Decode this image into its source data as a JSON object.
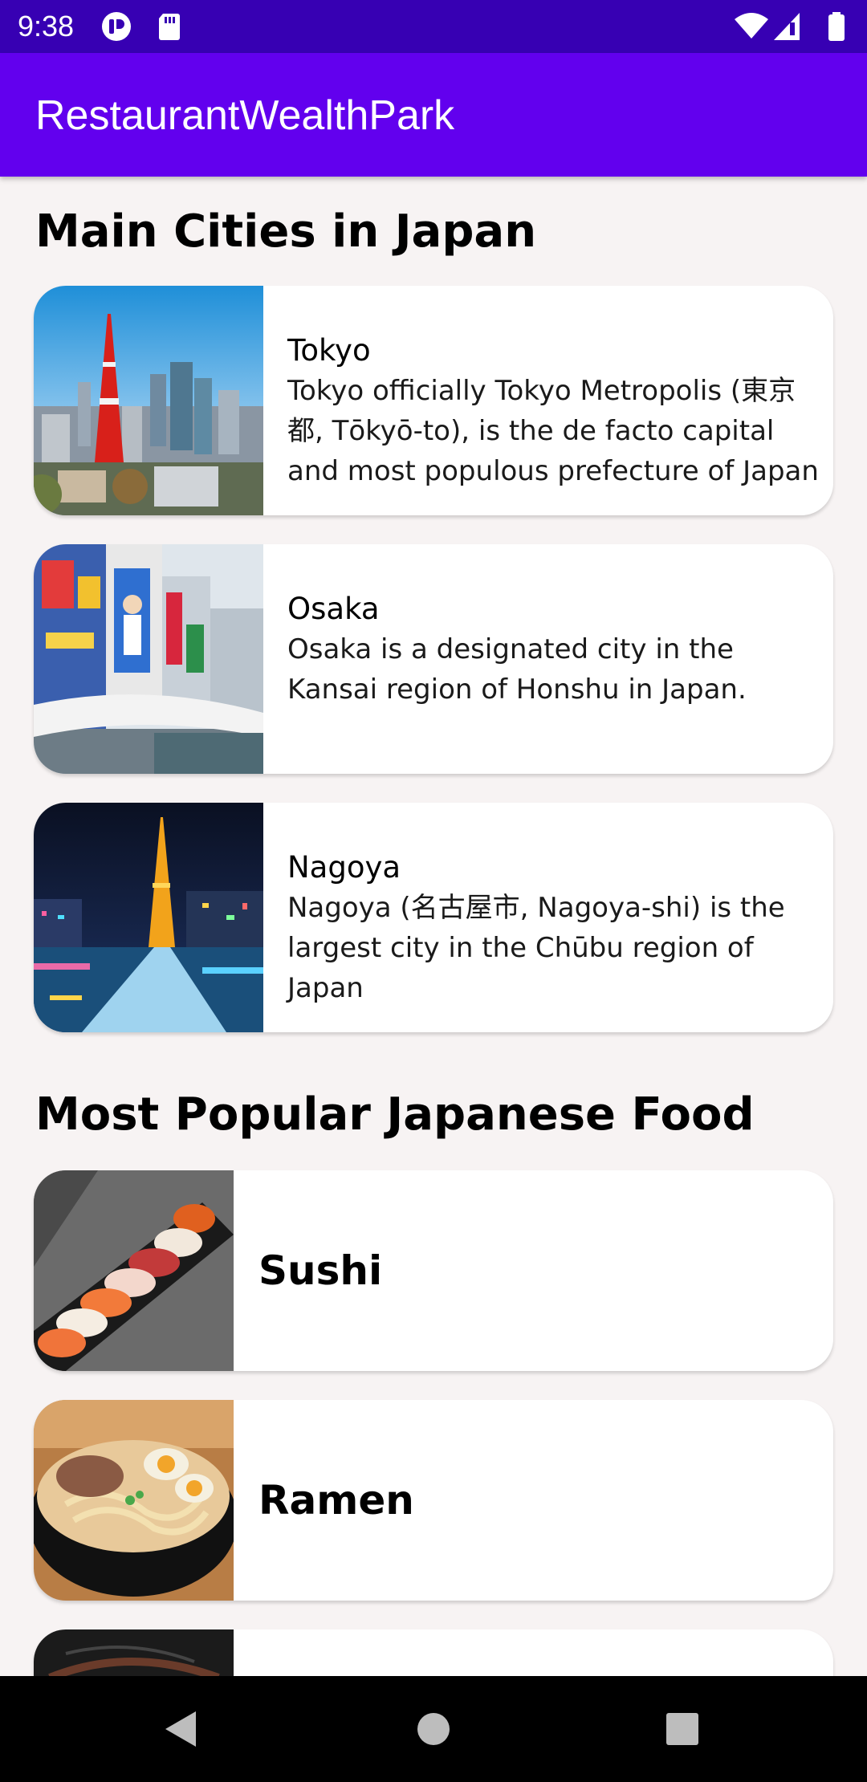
{
  "status_bar": {
    "time": "9:38",
    "left_icons": [
      "notification-icon",
      "sd-card-icon"
    ],
    "right_icons": [
      "wifi-icon",
      "signal-icon",
      "battery-icon"
    ]
  },
  "app_bar": {
    "title": "RestaurantWealthPark"
  },
  "cities_section": {
    "title": "Main Cities in Japan",
    "items": [
      {
        "name": "Tokyo",
        "description": "Tokyo officially Tokyo Metropolis (東京都, Tōkyō-to), is the de facto capital and most populous prefecture of Japan",
        "image": "tokyo-tower-photo"
      },
      {
        "name": "Osaka",
        "description": "Osaka is a designated city in the Kansai region of Honshu in Japan.",
        "image": "osaka-dotonbori-photo"
      },
      {
        "name": "Nagoya",
        "description": "Nagoya (名古屋市, Nagoya-shi) is the largest city in the Chūbu region of Japan",
        "image": "nagoya-tv-tower-photo"
      }
    ]
  },
  "food_section": {
    "title": "Most Popular Japanese Food",
    "items": [
      {
        "name": "Sushi",
        "image": "sushi-photo"
      },
      {
        "name": "Ramen",
        "image": "ramen-photo"
      },
      {
        "name": "",
        "image": "grilled-food-photo"
      }
    ]
  },
  "nav_bar": {
    "buttons": [
      "back-icon",
      "home-icon",
      "recents-icon"
    ]
  },
  "colors": {
    "status_bar": "#3700b3",
    "app_bar": "#6200ee",
    "background": "#f7f3f3",
    "card": "#ffffff"
  }
}
